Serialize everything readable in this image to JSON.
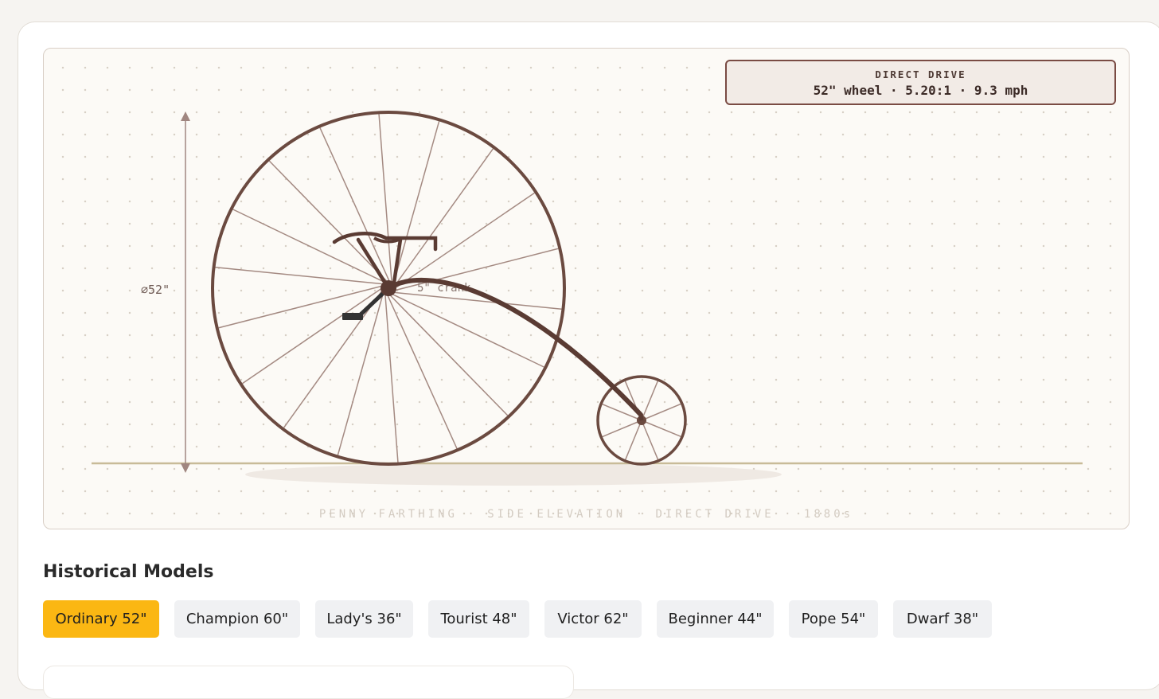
{
  "readout": {
    "mode": "DIRECT DRIVE",
    "specs": "52\" wheel · 5.20:1 · 9.3 mph"
  },
  "diagram": {
    "diameter_label": "⌀52\"",
    "crank_label": "5\" crank",
    "caption": "PENNY FARTHING · SIDE ELEVATION · DIRECT DRIVE · 1880s",
    "colors": {
      "frame": "#6b4a40",
      "spoke": "#a48a82",
      "ground": "#c8bb98",
      "pedal": "#333333",
      "dimension": "#a08680"
    }
  },
  "models_section": {
    "title": "Historical Models",
    "selected": "Ordinary 52\"",
    "items": [
      {
        "label": "Ordinary 52\""
      },
      {
        "label": "Champion 60\""
      },
      {
        "label": "Lady's 36\""
      },
      {
        "label": "Tourist 48\""
      },
      {
        "label": "Victor 62\""
      },
      {
        "label": "Beginner 44\""
      },
      {
        "label": "Pope 54\""
      },
      {
        "label": "Dwarf 38\""
      }
    ]
  }
}
